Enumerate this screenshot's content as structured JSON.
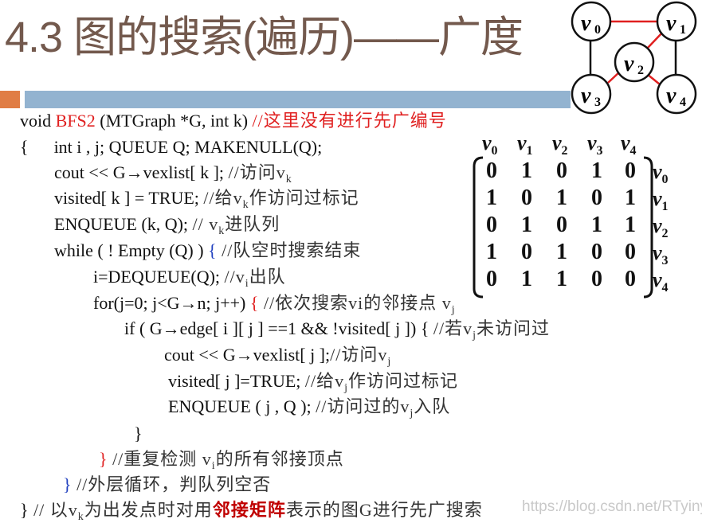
{
  "slide": {
    "title": "4.3 图的搜索(遍历)——广度",
    "colors": {
      "title": "#73594d",
      "bar_orange": "#e07d45",
      "bar_blue": "#93b3d0",
      "comment_red": "#e02020",
      "keyword_red": "#c00000",
      "brace_blue": "#1f3fbf",
      "edge_red": "#e02020"
    }
  },
  "graph": {
    "vertices": [
      {
        "id": "v0",
        "label": "v",
        "sub": "0"
      },
      {
        "id": "v1",
        "label": "v",
        "sub": "1"
      },
      {
        "id": "v2",
        "label": "v",
        "sub": "2"
      },
      {
        "id": "v3",
        "label": "v",
        "sub": "3"
      },
      {
        "id": "v4",
        "label": "v",
        "sub": "4"
      }
    ],
    "edges": [
      {
        "from": "v0",
        "to": "v1",
        "color": "red"
      },
      {
        "from": "v1",
        "to": "v2",
        "color": "red"
      },
      {
        "from": "v2",
        "to": "v3",
        "color": "red"
      },
      {
        "from": "v2",
        "to": "v4",
        "color": "red"
      },
      {
        "from": "v0",
        "to": "v3",
        "color": "black"
      },
      {
        "from": "v1",
        "to": "v4",
        "color": "black"
      }
    ]
  },
  "matrix": {
    "col_headers": [
      {
        "v": "v",
        "s": "0"
      },
      {
        "v": "v",
        "s": "1"
      },
      {
        "v": "v",
        "s": "2"
      },
      {
        "v": "v",
        "s": "3"
      },
      {
        "v": "v",
        "s": "4"
      }
    ],
    "row_headers": [
      {
        "v": "v",
        "s": "0"
      },
      {
        "v": "v",
        "s": "1"
      },
      {
        "v": "v",
        "s": "2"
      },
      {
        "v": "v",
        "s": "3"
      },
      {
        "v": "v",
        "s": "4"
      }
    ],
    "rows": [
      [
        "0",
        "1",
        "0",
        "1",
        "0"
      ],
      [
        "1",
        "0",
        "1",
        "0",
        "1"
      ],
      [
        "0",
        "1",
        "0",
        "1",
        "1"
      ],
      [
        "1",
        "0",
        "1",
        "0",
        "0"
      ],
      [
        "0",
        "1",
        "1",
        "0",
        "0"
      ]
    ]
  },
  "code": {
    "l1": {
      "a": "void ",
      "fn": "BFS2",
      "b": " (MTGraph *G, int k) ",
      "c": "//这里没有进行先广编号"
    },
    "l2": {
      "brace": "{",
      "a": "int i , j; QUEUE Q;   MAKENULL(Q);"
    },
    "l3": {
      "a": "cout << G→vexlist[ k ];  ",
      "c": "//访问v",
      "sub": "k"
    },
    "l4": {
      "a": "visited[ k ] = TRUE; ",
      "c1": "//给v",
      "sub": "k",
      "c2": "作访问过标记"
    },
    "l5": {
      "a": "ENQUEUE (k, Q);  ",
      "c1": "// v",
      "sub": "k",
      "c2": "进队列"
    },
    "l6": {
      "a": "while ( ! Empty (Q) ) ",
      "brace": "{",
      "c": " //队空时搜索结束"
    },
    "l7": {
      "a": "i=DEQUEUE(Q); ",
      "c1": "//v",
      "sub": "i",
      "c2": "出队"
    },
    "l8": {
      "a": "for(j=0; j<G→n; j++) ",
      "brace": "{",
      "c1": "  //依次搜索vi的邻接点 v",
      "sub": "j"
    },
    "l9": {
      "a": "if ( G→edge[ i ][ j ] ==1 && !visited[ j ]) { ",
      "c1": "//若v",
      "sub": "j",
      "c2": "未访问过"
    },
    "l10": {
      "a": "cout << G→vexlist[ j ];",
      "c1": "//访问v",
      "sub": "j"
    },
    "l11": {
      "a": "visited[ j ]=TRUE;  ",
      "c1": "//给v",
      "sub": "j",
      "c2": "作访问过标记"
    },
    "l12": {
      "a": "ENQUEUE ( j , Q ); ",
      "c1": "//访问过的v",
      "sub": "j",
      "c2": "入队"
    },
    "l13": {
      "brace": "}"
    },
    "l14": {
      "brace": "}",
      "c1": " //重复检测 v",
      "sub": "i",
      "c2": "的所有邻接顶点"
    },
    "l15": {
      "brace": "}",
      "c": " //外层循环，判队列空否"
    },
    "l16": {
      "brace": "}",
      "c1": " // 以v",
      "sub": "k",
      "c2": "为出发点时对用",
      "hl": "邻接矩阵",
      "c3": "表示的图G进行先广搜索"
    }
  },
  "watermark": "https://blog.csdn.net/RTyinying"
}
